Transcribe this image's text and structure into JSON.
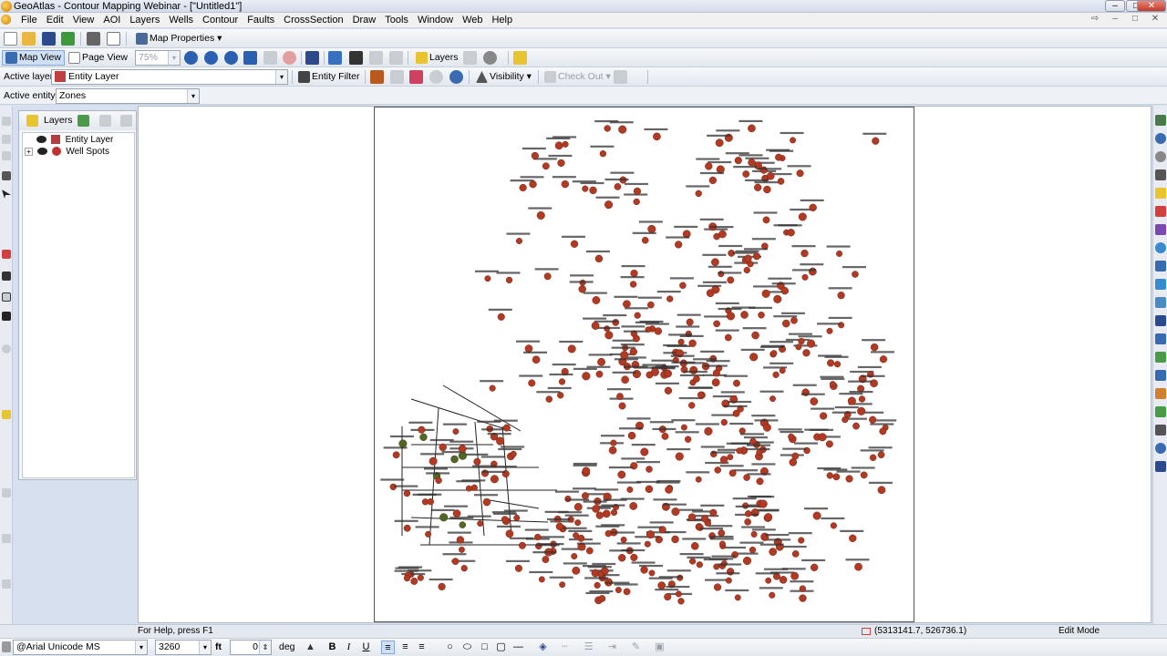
{
  "window": {
    "title": "GeoAtlas - Contour Mapping Webinar - [\"Untitled1\"]",
    "buttons": {
      "minimize": "–",
      "maximize": "□",
      "close": "✕"
    }
  },
  "menubar": {
    "items": [
      "File",
      "Edit",
      "View",
      "AOI",
      "Layers",
      "Wells",
      "Contour",
      "Faults",
      "CrossSection",
      "Draw",
      "Tools",
      "Window",
      "Web",
      "Help"
    ]
  },
  "toolbar1": {
    "map_properties": "Map Properties"
  },
  "toolbar2": {
    "map_view": "Map View",
    "page_view": "Page View",
    "zoom_value": "75%",
    "layers": "Layers"
  },
  "toolbar3": {
    "active_layer_label": "Active layer",
    "active_layer_value": "Entity Layer",
    "entity_filter": "Entity Filter",
    "visibility": "Visibility",
    "check_out": "Check Out"
  },
  "toolbar4": {
    "active_entity_label": "Active entity",
    "active_entity_value": "Zones"
  },
  "layers_panel": {
    "title": "Layers",
    "nodes": [
      {
        "label": "Entity Layer"
      },
      {
        "label": "Well Spots",
        "expand": "+"
      }
    ]
  },
  "map": {
    "well_color": "#b23a22",
    "well_green_color": "#4c6a20",
    "label_color": "#333333"
  },
  "statusbar": {
    "help": "For Help, press F1",
    "coords": "(5313141.7, 526736.1)",
    "mode": "Edit Mode"
  },
  "format_toolbar": {
    "font": "@Arial Unicode MS",
    "size": "3260",
    "unit": "ft",
    "angle": "0",
    "angle_unit": "deg",
    "bold": "B",
    "italic": "I",
    "underline": "U"
  }
}
